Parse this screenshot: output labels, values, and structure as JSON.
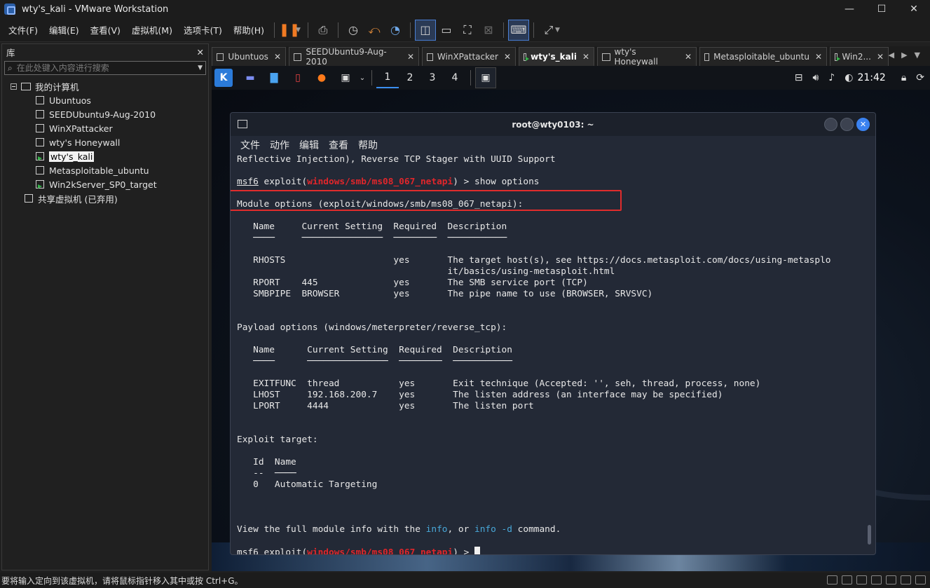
{
  "window": {
    "title": "wty's_kali - VMware Workstation",
    "minimize": "—",
    "maximize": "☐",
    "close": "✕"
  },
  "menu": [
    "文件(F)",
    "编辑(E)",
    "查看(V)",
    "虚拟机(M)",
    "选项卡(T)",
    "帮助(H)"
  ],
  "library": {
    "title": "库",
    "close": "✕",
    "search_placeholder": "在此处键入内容进行搜索",
    "root": "我的计算机",
    "vms": [
      {
        "name": "Ubuntuos",
        "running": false
      },
      {
        "name": "SEEDUbuntu9-Aug-2010",
        "running": false
      },
      {
        "name": "WinXPattacker",
        "running": false
      },
      {
        "name": "wty's Honeywall",
        "running": false
      },
      {
        "name": "wty's_kali",
        "running": true,
        "selected": true
      },
      {
        "name": "Metasploitable_ubuntu",
        "running": false
      },
      {
        "name": "Win2kServer_SP0_target",
        "running": true
      }
    ],
    "shared": "共享虚拟机 (已弃用)"
  },
  "tabs": [
    {
      "label": "Ubuntuos",
      "active": false,
      "running": false
    },
    {
      "label": "SEEDUbuntu9-Aug-2010",
      "active": false,
      "running": false
    },
    {
      "label": "WinXPattacker",
      "active": false,
      "running": false
    },
    {
      "label": "wty's_kali",
      "active": true,
      "running": true
    },
    {
      "label": "wty's Honeywall",
      "active": false,
      "running": false
    },
    {
      "label": "Metasploitable_ubuntu",
      "active": false,
      "running": false
    },
    {
      "label": "Win2...",
      "active": false,
      "running": true
    }
  ],
  "kali_panel": {
    "workspaces": [
      "1",
      "2",
      "3",
      "4"
    ],
    "active_workspace": "1",
    "clock": "21:42"
  },
  "terminal": {
    "title": "root@wty0103: ~",
    "menu": [
      "文件",
      "动作",
      "编辑",
      "查看",
      "帮助"
    ],
    "prompt_user": "msf6",
    "prompt_cmd": "exploit(",
    "prompt_module": "windows/smb/ms08_067_netapi",
    "prompt_tail": ") > ",
    "command": "show options",
    "line0": "Reflective Injection), Reverse TCP Stager with UUID Support",
    "module_header": "Module options (exploit/windows/smb/ms08_067_netapi):",
    "module_cols": "   Name     Current Setting  Required  Description",
    "module_rule": "   ────     ───────────────  ────────  ───────────",
    "module_rows": [
      "   RHOSTS                    yes       The target host(s), see https://docs.metasploit.com/docs/using-metasplo",
      "                                       it/basics/using-metasploit.html",
      "   RPORT    445              yes       The SMB service port (TCP)",
      "   SMBPIPE  BROWSER          yes       The pipe name to use (BROWSER, SRVSVC)"
    ],
    "payload_header": "Payload options (windows/meterpreter/reverse_tcp):",
    "payload_cols": "   Name      Current Setting  Required  Description",
    "payload_rule": "   ────      ───────────────  ────────  ───────────",
    "payload_rows": [
      "   EXITFUNC  thread           yes       Exit technique (Accepted: '', seh, thread, process, none)",
      "   LHOST     192.168.200.7    yes       The listen address (an interface may be specified)",
      "   LPORT     4444             yes       The listen port"
    ],
    "target_header": "Exploit target:",
    "target_cols": "   Id  Name",
    "target_rule": "   --  ────",
    "target_row": "   0   Automatic Targeting",
    "info_pre": "View the full module info with the ",
    "info_a": "info",
    "info_mid": ", or ",
    "info_b": "info -d",
    "info_post": " command."
  },
  "status": "要将输入定向到该虚拟机，请将鼠标指针移入其中或按 Ctrl+G。"
}
